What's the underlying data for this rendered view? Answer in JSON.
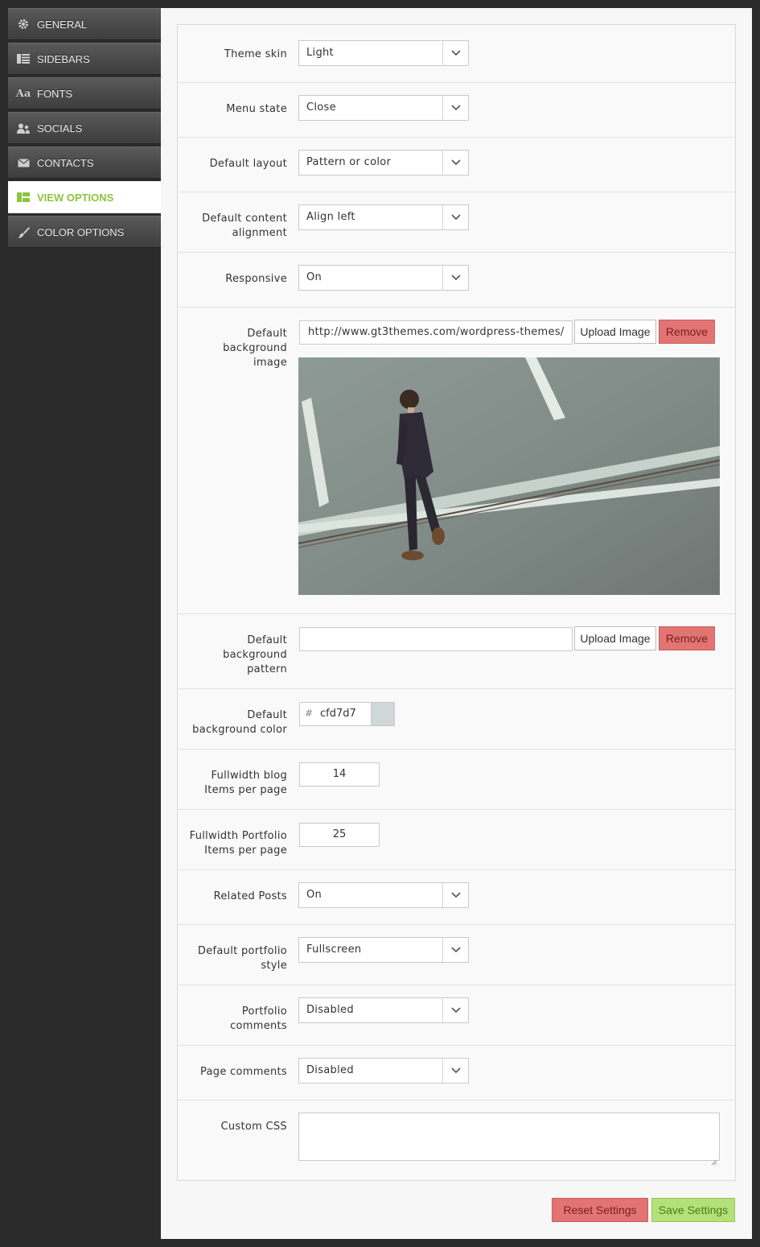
{
  "sidebar": {
    "items": [
      {
        "label": "GENERAL",
        "icon": "gear-icon"
      },
      {
        "label": "SIDEBARS",
        "icon": "sidebar-icon"
      },
      {
        "label": "FONTS",
        "icon": "font-icon"
      },
      {
        "label": "SOCIALS",
        "icon": "users-icon"
      },
      {
        "label": "CONTACTS",
        "icon": "envelope-icon"
      },
      {
        "label": "VIEW OPTIONS",
        "icon": "layout-icon",
        "active": true
      },
      {
        "label": "COLOR OPTIONS",
        "icon": "brush-icon"
      }
    ]
  },
  "form": {
    "theme_skin": {
      "label": "Theme skin",
      "value": "Light"
    },
    "menu_state": {
      "label": "Menu state",
      "value": "Close"
    },
    "default_layout": {
      "label": "Default layout",
      "value": "Pattern or color"
    },
    "content_alignment": {
      "label_line1": "Default content",
      "label_line2": "alignment",
      "value": "Align left"
    },
    "responsive": {
      "label": "Responsive",
      "value": "On"
    },
    "bg_image": {
      "label_line1": "Default",
      "label_line2": "background",
      "label_line3": "image",
      "value": "http://www.gt3themes.com/wordpress-themes/",
      "upload_label": "Upload Image",
      "remove_label": "Remove"
    },
    "bg_pattern": {
      "label_line1": "Default",
      "label_line2": "background",
      "label_line3": "pattern",
      "value": "",
      "upload_label": "Upload Image",
      "remove_label": "Remove"
    },
    "bg_color": {
      "label_line1": "Default",
      "label_line2": "background color",
      "hash": "#",
      "value": "cfd7d7",
      "swatch": "#cfd7d7"
    },
    "blog_items": {
      "label_line1": "Fullwidth blog",
      "label_line2": "Items per page",
      "value": "14"
    },
    "portfolio_items": {
      "label_line1": "Fullwidth Portfolio",
      "label_line2": "Items per page",
      "value": "25"
    },
    "related_posts": {
      "label": "Related Posts",
      "value": "On"
    },
    "portfolio_style": {
      "label_line1": "Default portfolio",
      "label_line2": "style",
      "value": "Fullscreen"
    },
    "portfolio_comments": {
      "label_line1": "Portfolio",
      "label_line2": "comments",
      "value": "Disabled"
    },
    "page_comments": {
      "label": "Page comments",
      "value": "Disabled"
    },
    "custom_css": {
      "label": "Custom CSS",
      "value": ""
    }
  },
  "footer": {
    "reset_label": "Reset Settings",
    "save_label": "Save Settings"
  },
  "colors": {
    "accent": "#8cc43c",
    "danger": "#e27474",
    "success": "#b4e07a"
  }
}
